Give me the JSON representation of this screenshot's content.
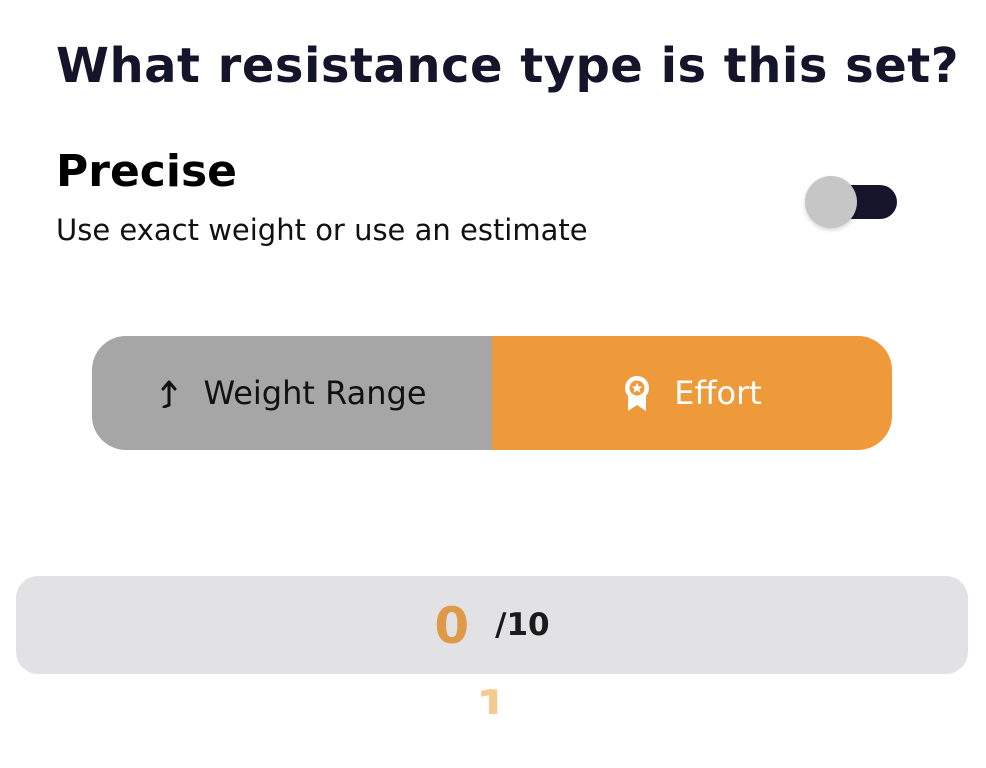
{
  "question": {
    "title": "What resistance type is this set?"
  },
  "precise": {
    "title": "Precise",
    "subtitle": "Use exact weight or use an estimate",
    "toggle_on": true
  },
  "resistance_type": {
    "options": [
      {
        "label": "Weight Range",
        "icon": "weight-range-arrow-icon",
        "selected": false
      },
      {
        "label": "Effort",
        "icon": "award-badge-icon",
        "selected": true
      }
    ]
  },
  "effort": {
    "value": "0",
    "max_label": "/10",
    "next_value": "1"
  },
  "colors": {
    "accent_orange": "#ef9a3a",
    "score_orange": "#df9a49",
    "dark_navy": "#14142b",
    "segment_gray": "#a6a6a6",
    "score_box_gray": "#e2e2e4",
    "toggle_knob": "#c6c6c6"
  }
}
